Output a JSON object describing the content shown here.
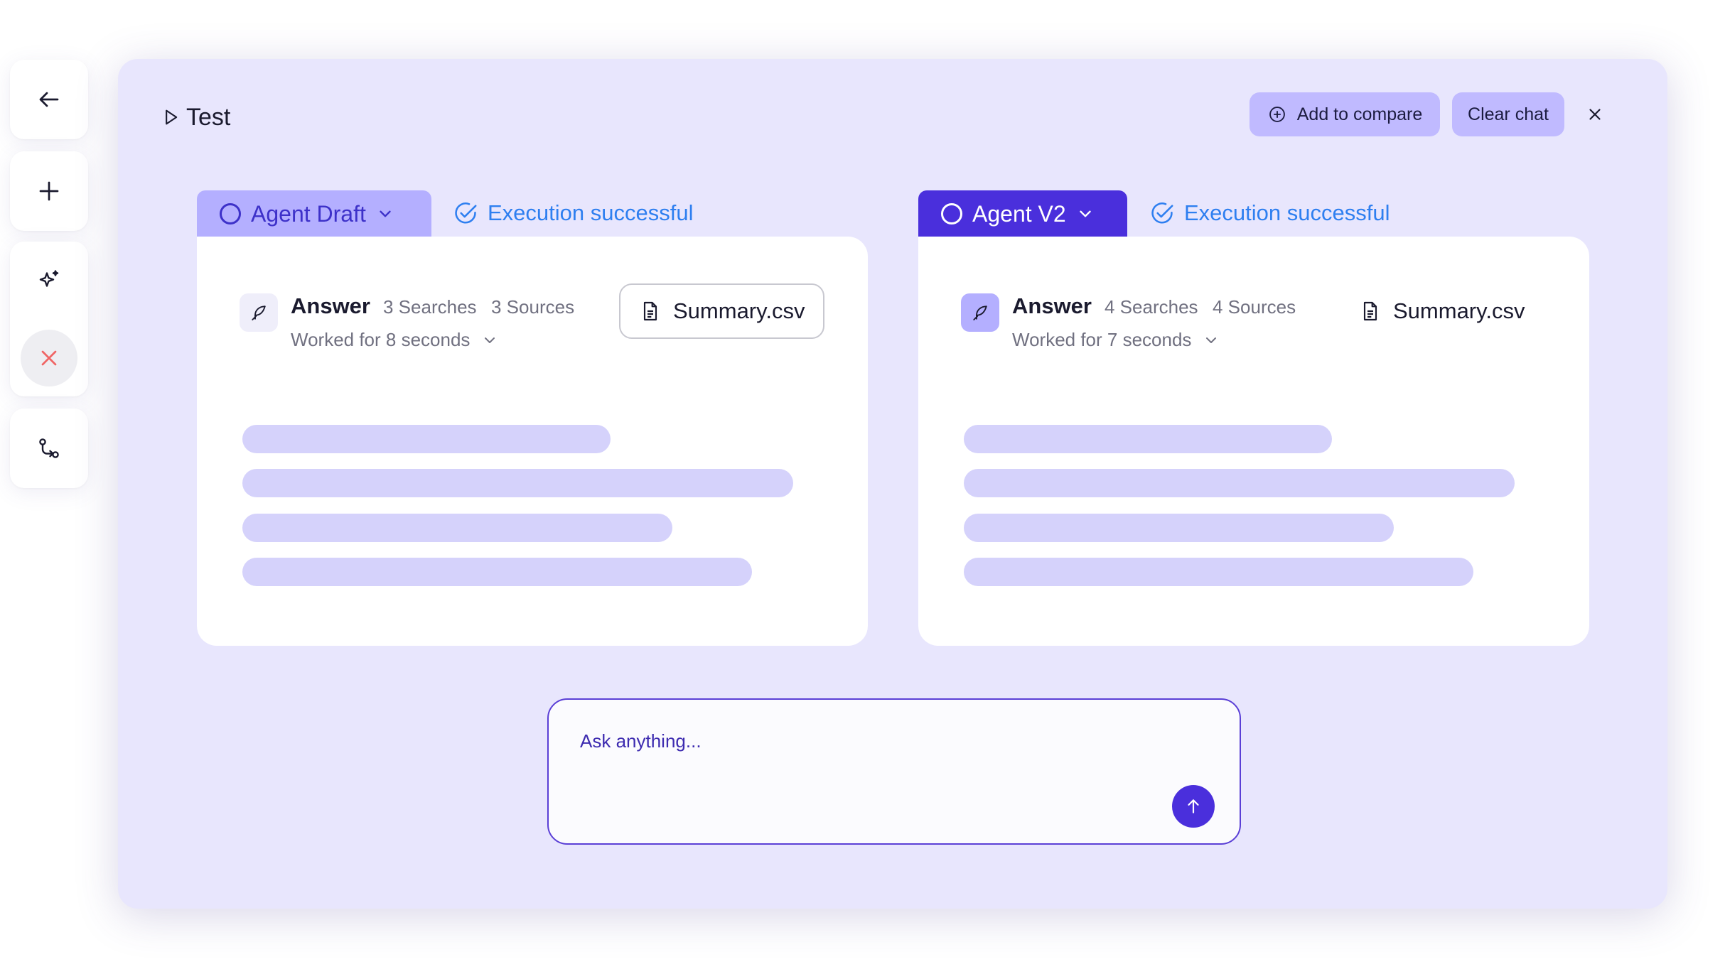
{
  "sidebar": {
    "tools": [
      {
        "icon": "arrow-left-icon"
      },
      {
        "icon": "plus-icon"
      },
      {
        "icon": "sparkle-icon"
      },
      {
        "icon": "close-icon",
        "active": true
      },
      {
        "icon": "git-compare-icon"
      }
    ]
  },
  "header": {
    "title": "Test",
    "add_to_compare_label": "Add to compare",
    "clear_chat_label": "Clear chat"
  },
  "agents": [
    {
      "tab_label": "Agent Draft",
      "status": "Execution successful",
      "answer_title": "Answer",
      "searches": "3 Searches",
      "sources": "3 Sources",
      "worked_for": "Worked for 8 seconds",
      "file_name": "Summary.csv"
    },
    {
      "tab_label": "Agent V2",
      "status": "Execution successful",
      "answer_title": "Answer",
      "searches": "4 Searches",
      "sources": "4 Sources",
      "worked_for": "Worked for 7 seconds",
      "file_name": "Summary.csv"
    }
  ],
  "composer": {
    "placeholder": "Ask anything..."
  },
  "colors": {
    "panel_bg": "#e8e6fd",
    "accent": "#4a2fdc",
    "tab_light": "#b4afff",
    "button_bg": "#c0baff",
    "status_blue": "#2e7ff0",
    "skeleton": "#d5d2fb"
  }
}
